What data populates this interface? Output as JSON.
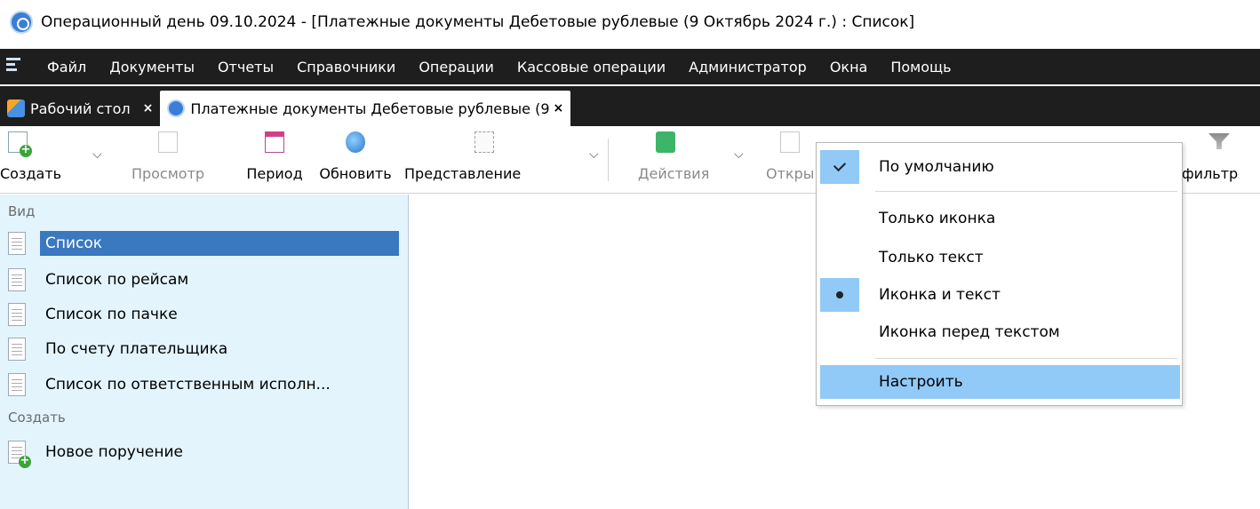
{
  "window": {
    "title": "Операционный день 09.10.2024 - [Платежные документы Дебетовые рублевые (9 Октябрь 2024 г.) : Список]"
  },
  "menubar": {
    "items": [
      "Файл",
      "Документы",
      "Отчеты",
      "Справочники",
      "Операции",
      "Кассовые операции",
      "Администратор",
      "Окна",
      "Помощь"
    ]
  },
  "tabs": [
    {
      "label": "Рабочий стол",
      "close": "×",
      "icon": "desktop-icon"
    },
    {
      "label": "Платежные документы Дебетовые рублевые (9",
      "close": "×",
      "icon": "app-logo-icon"
    }
  ],
  "toolbar": {
    "create": "Создать",
    "view": "Просмотр",
    "period": "Период",
    "refresh": "Обновить",
    "representation": "Представление",
    "actions": "Действия",
    "open": "Откры",
    "filter": "фильтр"
  },
  "left_panel": {
    "view_header": "Вид",
    "view_items": [
      "Список",
      "Список по рейсам",
      "Список по пачке",
      "По счету плательщика",
      "Список по ответственным исполн..."
    ],
    "selected_index": 0,
    "create_header": "Создать",
    "create_items": [
      "Новое поручение"
    ]
  },
  "context_menu": {
    "items": [
      {
        "label": "По умолчанию",
        "mark": "check"
      },
      {
        "label": "Только иконка",
        "mark": ""
      },
      {
        "label": "Только текст",
        "mark": ""
      },
      {
        "label": "Иконка и текст",
        "mark": "dot"
      },
      {
        "label": "Иконка перед текстом",
        "mark": ""
      },
      {
        "label": "Настроить",
        "mark": "",
        "highlighted": true
      }
    ]
  },
  "colors": {
    "menubar_bg": "#1e1e1e",
    "panel_bg": "#e4f4fd",
    "selection": "#3a78c0",
    "menu_highlight": "#91c9f7"
  }
}
